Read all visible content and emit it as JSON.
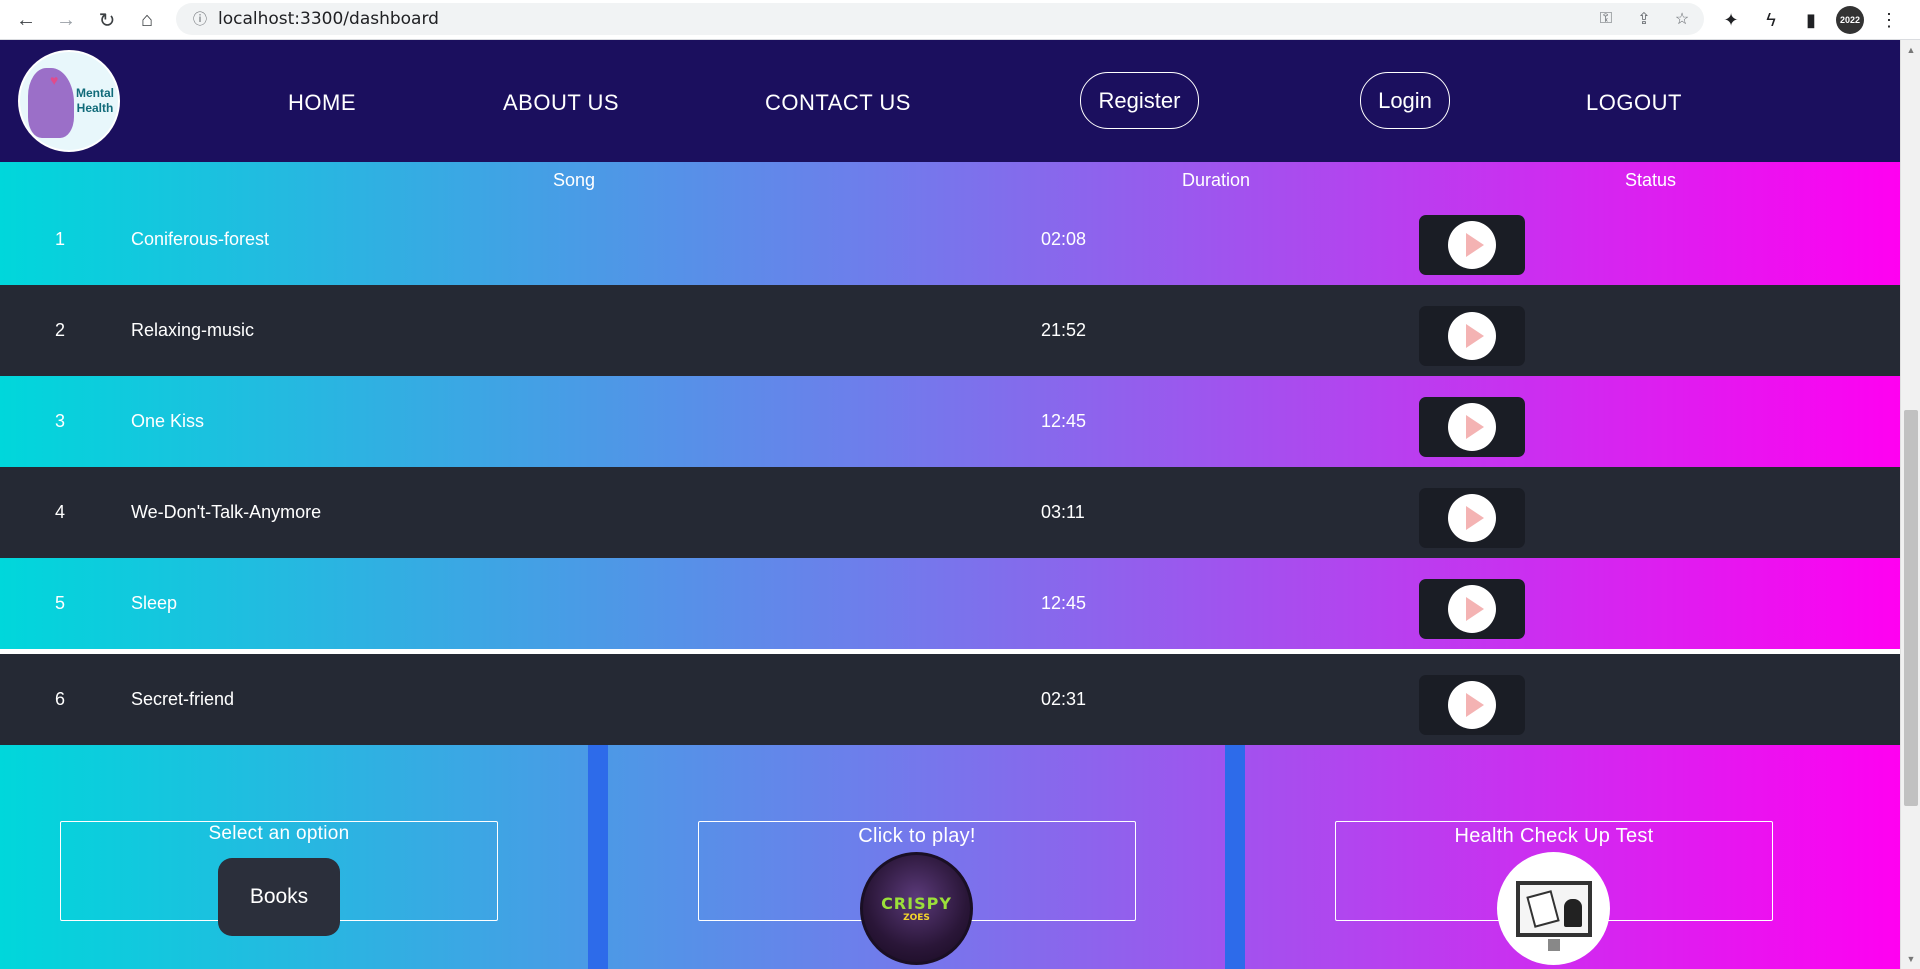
{
  "browser": {
    "url": "localhost:3300/dashboard",
    "profile_label": "2022"
  },
  "navbar": {
    "logo_text_line1": "Mental",
    "logo_text_line2": "Health",
    "home": "HOME",
    "about": "ABOUT US",
    "contact": "CONTACT US",
    "register": "Register",
    "login": "Login",
    "logout": "LOGOUT"
  },
  "table": {
    "headers": {
      "song": "Song",
      "duration": "Duration",
      "status": "Status"
    },
    "rows": [
      {
        "num": "1",
        "song": "Coniferous-forest",
        "duration": "02:08"
      },
      {
        "num": "2",
        "song": "Relaxing-music",
        "duration": "21:52"
      },
      {
        "num": "3",
        "song": "One Kiss",
        "duration": "12:45"
      },
      {
        "num": "4",
        "song": "We-Don't-Talk-Anymore",
        "duration": "03:11"
      },
      {
        "num": "5",
        "song": "Sleep",
        "duration": "12:45"
      },
      {
        "num": "6",
        "song": "Secret-friend",
        "duration": "02:31"
      }
    ]
  },
  "cards": {
    "select_title": "Select an option",
    "books_button": "Books",
    "play_title": "Click to play!",
    "game_logo_line1": "CRISPY",
    "game_logo_line2": "ZOES",
    "health_title": "Health Check Up Test"
  },
  "colors": {
    "navbar_bg": "#1b0f5e",
    "dark_row": "#252934",
    "gradient_start": "#00d7db",
    "gradient_end": "#ff00f1",
    "divider": "#2d6bea"
  }
}
